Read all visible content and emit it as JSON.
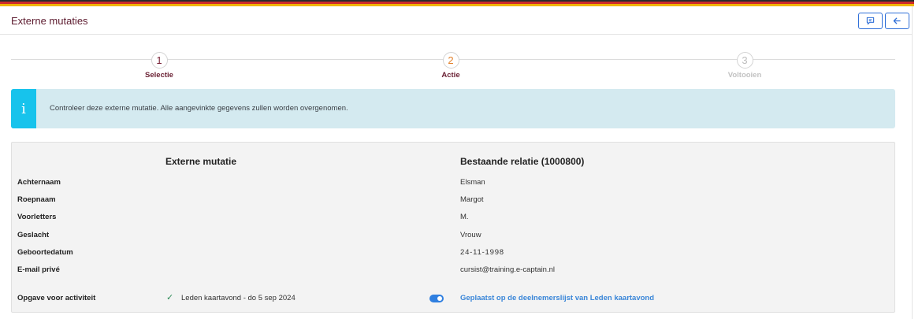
{
  "header": {
    "title": "Externe mutaties",
    "buttons": [
      {
        "icon": "comment-icon"
      },
      {
        "icon": "arrow-left-icon"
      }
    ],
    "flag_colors": [
      "#2a2a2a",
      "#cc2a2a",
      "#f0b400"
    ]
  },
  "stepper": {
    "steps": [
      {
        "number": "1",
        "label": "Selectie",
        "state": "done"
      },
      {
        "number": "2",
        "label": "Actie",
        "state": "current"
      },
      {
        "number": "3",
        "label": "Voltooien",
        "state": "upcoming"
      }
    ]
  },
  "info": {
    "icon": "info-icon",
    "icon_glyph": "i",
    "message": "Controleer deze externe mutatie. Alle aangevinkte gegevens zullen worden overgenomen.",
    "accent_color": "#17c3ec"
  },
  "comparison": {
    "left_header": "Externe mutatie",
    "right_header": "Bestaande relatie (1000800)",
    "rows": [
      {
        "label": "Achternaam",
        "external": "",
        "existing": "Elsman"
      },
      {
        "label": "Roepnaam",
        "external": "",
        "existing": "Margot"
      },
      {
        "label": "Voorletters",
        "external": "",
        "existing": "M."
      },
      {
        "label": "Geslacht",
        "external": "",
        "existing": "Vrouw"
      },
      {
        "label": "Geboortedatum",
        "external": "",
        "existing": "24-11-1998"
      },
      {
        "label": "E-mail privé",
        "external": "",
        "existing": "cursist@training.e-captain.nl"
      }
    ],
    "activity": {
      "label": "Opgave voor activiteit",
      "check_icon": "check-icon",
      "description": "Leden kaartavond - do 5 sep 2024",
      "toggle_on": true,
      "result_link": "Geplaatst op de deelnemerslijst van Leden kaartavond"
    }
  }
}
